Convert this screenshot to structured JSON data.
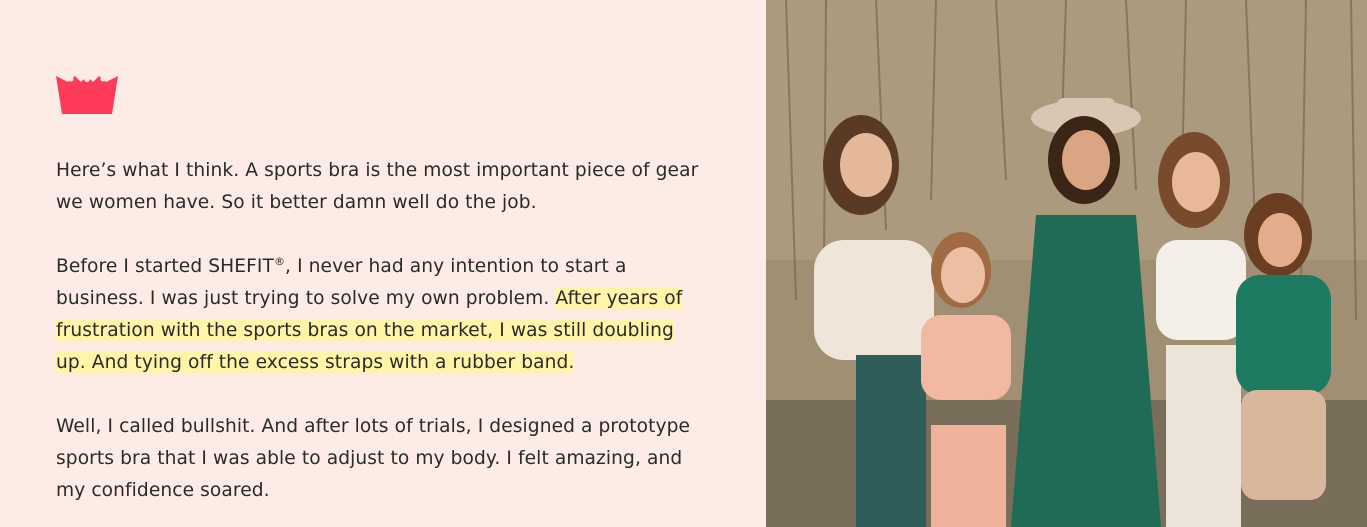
{
  "brand": {
    "accent_color": "#ff3b5c",
    "logo_icon": "crown-icon"
  },
  "story": {
    "p1": "Here’s what I think. A sports bra is the most important piece of gear we women have. So it better damn well do the job.",
    "p2_start": "Before I started SHEFIT",
    "p2_reg": "®",
    "p2_mid": ", I never had any intention to start a business. I was just trying to solve my own problem. ",
    "p2_highlight": "After years of frustration with the sports bras on the market, I was still doubling up. And tying off the excess straps with a rubber band.",
    "p3": "Well, I called bullshit. And after lots of trials, I designed a prototype sports bra that I was able to adjust to my body. I felt amazing, and my confidence soared."
  },
  "photo": {
    "subject": "family-photo"
  }
}
